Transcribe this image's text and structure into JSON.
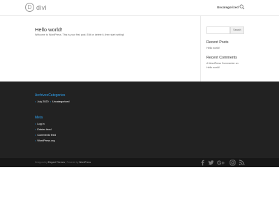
{
  "header": {
    "logo_mark": "D",
    "logo_text": "divi",
    "nav_item": "Uncategorized"
  },
  "post": {
    "title": "Hello world!",
    "body": "Welcome to WordPress. This is your first post. Edit or delete it, then start writing!"
  },
  "sidebar": {
    "search_button": "Search",
    "recent_posts_title": "Recent Posts",
    "recent_post_item": "Hello world!",
    "recent_comments_title": "Recent Comments",
    "comment_author": "A WordPress Commenter",
    "comment_on": "on",
    "comment_post": "Hello world!"
  },
  "footer": {
    "archives_title": "Archives",
    "categories_title": "Categories",
    "archives_item": "July 2020",
    "categories_item": "Uncategorized",
    "meta_title": "Meta",
    "meta_items": [
      "Log in",
      "Entries feed",
      "Comments feed",
      "WordPress.org"
    ],
    "credit_prefix": "Designed by",
    "credit_designer": "Elegant Themes",
    "credit_sep": "| Powered by",
    "credit_platform": "WordPress"
  },
  "colors": {
    "accent": "#2ea3f2",
    "footer_bg": "#222222",
    "bottom_bar_bg": "#171717"
  }
}
